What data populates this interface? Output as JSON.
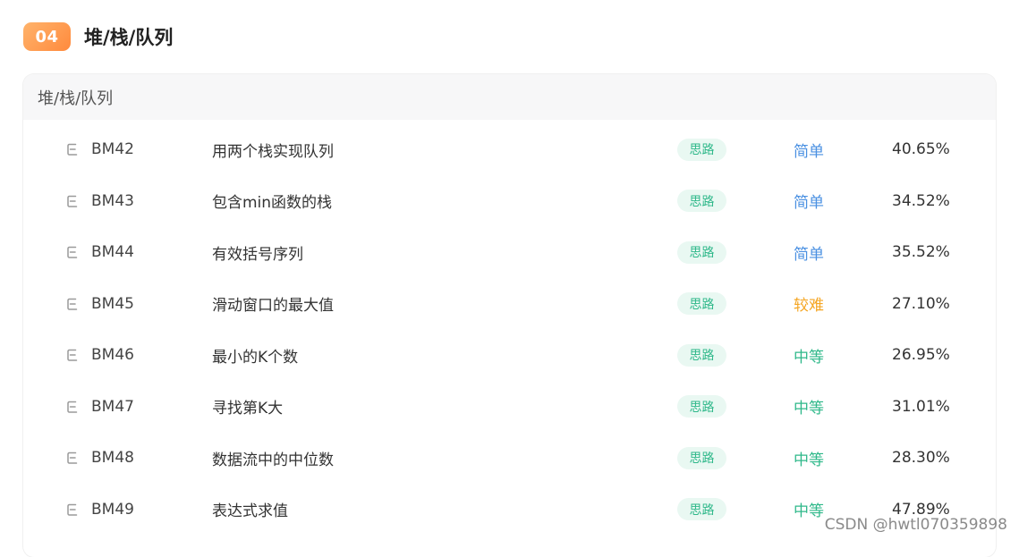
{
  "section": {
    "number": "04",
    "title": "堆/栈/队列"
  },
  "card": {
    "header": "堆/栈/队列"
  },
  "colors": {
    "easy": "#4a90e2",
    "hard": "#f5a623",
    "medium": "#2fb88a"
  },
  "problems": [
    {
      "code": "BM42",
      "name": "用两个栈实现队列",
      "tag": "思路",
      "difficulty": "简单",
      "level": "easy",
      "rate": "40.65%"
    },
    {
      "code": "BM43",
      "name": "包含min函数的栈",
      "tag": "思路",
      "difficulty": "简单",
      "level": "easy",
      "rate": "34.52%"
    },
    {
      "code": "BM44",
      "name": "有效括号序列",
      "tag": "思路",
      "difficulty": "简单",
      "level": "easy",
      "rate": "35.52%"
    },
    {
      "code": "BM45",
      "name": "滑动窗口的最大值",
      "tag": "思路",
      "difficulty": "较难",
      "level": "hard",
      "rate": "27.10%"
    },
    {
      "code": "BM46",
      "name": "最小的K个数",
      "tag": "思路",
      "difficulty": "中等",
      "level": "medium",
      "rate": "26.95%"
    },
    {
      "code": "BM47",
      "name": "寻找第K大",
      "tag": "思路",
      "difficulty": "中等",
      "level": "medium",
      "rate": "31.01%"
    },
    {
      "code": "BM48",
      "name": "数据流中的中位数",
      "tag": "思路",
      "difficulty": "中等",
      "level": "medium",
      "rate": "28.30%"
    },
    {
      "code": "BM49",
      "name": "表达式求值",
      "tag": "思路",
      "difficulty": "中等",
      "level": "medium",
      "rate": "47.89%"
    }
  ],
  "watermark": "CSDN @hwtl070359898"
}
